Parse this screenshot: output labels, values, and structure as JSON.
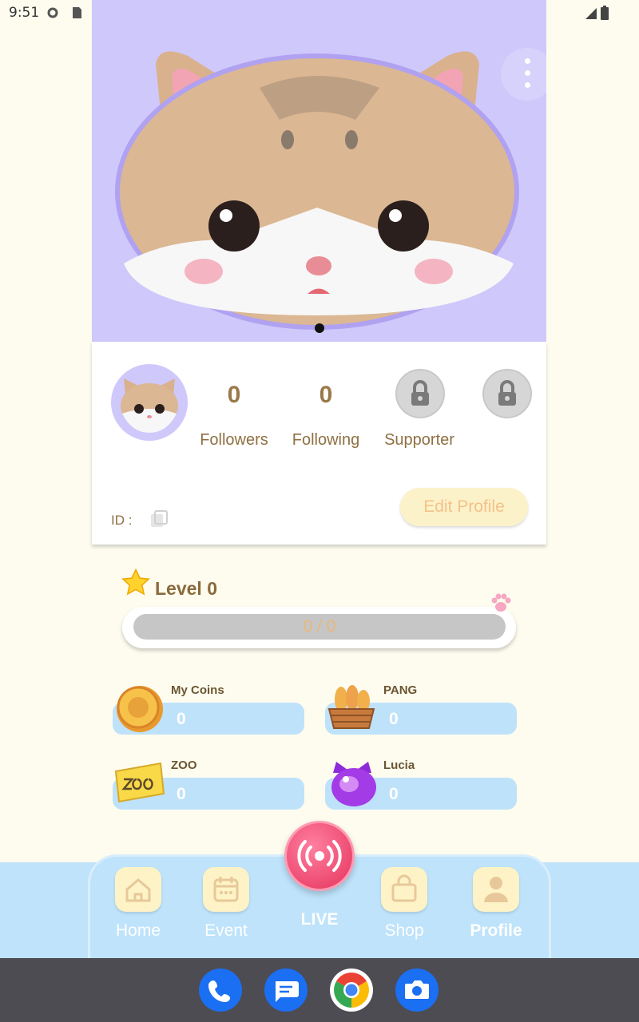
{
  "status_bar": {
    "time": "9:51"
  },
  "profile": {
    "stats": [
      {
        "value": "0",
        "label": "Followers"
      },
      {
        "value": "0",
        "label": "Following"
      }
    ],
    "supporter_label": "Supporter",
    "id_label": "ID :",
    "edit_button": "Edit Profile"
  },
  "level": {
    "title": "Level 0",
    "progress_text": "0 / 0",
    "progress_fraction": 0
  },
  "wallet": [
    {
      "label": "My Coins",
      "value": "0",
      "icon": "gold-coin-icon"
    },
    {
      "label": "PANG",
      "value": "0",
      "icon": "bread-basket-icon"
    },
    {
      "label": "ZOO",
      "value": "0",
      "icon": "zoo-ticket-icon"
    },
    {
      "label": "Lucia",
      "value": "0",
      "icon": "purple-cat-gem-icon"
    }
  ],
  "nav": {
    "home": "Home",
    "event": "Event",
    "live": "LIVE",
    "shop": "Shop",
    "profile": "Profile",
    "active": "Profile"
  },
  "colors": {
    "background": "#fdfcee",
    "banner": "#cfc8fb",
    "accent_brown": "#8f7043",
    "nav_blue": "#bee3fb",
    "live_pink": "#e5335c"
  }
}
